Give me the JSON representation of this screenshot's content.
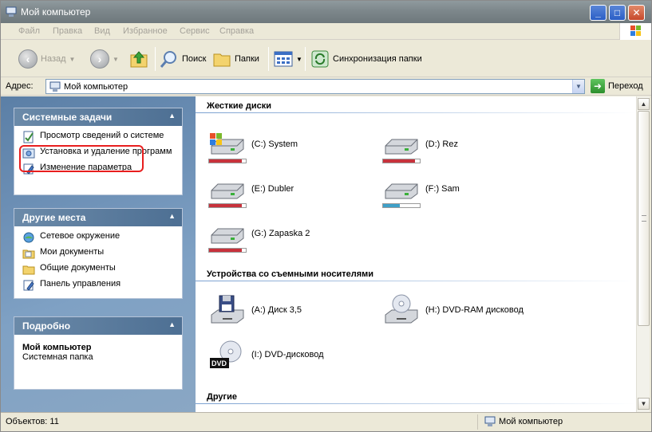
{
  "window": {
    "title": "Мой компьютер",
    "min_glyph": "_",
    "max_glyph": "□",
    "close_glyph": "✕"
  },
  "menu": {
    "items": [
      "Файл",
      "Правка",
      "Вид",
      "Избранное",
      "Сервис",
      "Справка"
    ]
  },
  "toolbar": {
    "back": "Назад",
    "search": "Поиск",
    "folders": "Папки",
    "sync": "Синхронизация папки"
  },
  "address": {
    "label": "Адрес:",
    "value": "Мой компьютер",
    "go": "Переход"
  },
  "left": {
    "system_tasks": {
      "title": "Системные задачи",
      "items": [
        "Просмотр сведений о системе",
        "Установка и удаление программ",
        "Изменение параметра"
      ]
    },
    "other_places": {
      "title": "Другие места",
      "items": [
        "Сетевое окружение",
        "Мои документы",
        "Общие документы",
        "Панель управления"
      ]
    },
    "details": {
      "title": "Подробно",
      "name": "Мой компьютер",
      "sub": "Системная папка"
    }
  },
  "right": {
    "hard_drives_title": "Жесткие диски",
    "hard_drives": [
      {
        "label": "(C:) System",
        "used": 0.9
      },
      {
        "label": "(D:) Rez",
        "used": 0.88
      },
      {
        "label": "(E:) Dubler",
        "used": 0.9
      },
      {
        "label": "(F:) Sam",
        "used": 0.45
      },
      {
        "label": "(G:) Zapaska 2",
        "used": 0.9
      }
    ],
    "removable_title": "Устройства со съемными носителями",
    "removable": [
      {
        "label": "(A:) Диск 3,5"
      },
      {
        "label": "(H:) DVD-RAM дисковод"
      },
      {
        "label": "(I:) DVD-дисковод",
        "badge": "DVD"
      }
    ],
    "other_title": "Другие"
  },
  "status": {
    "objects": "Объектов: 11",
    "location": "Мой компьютер"
  },
  "colors": {
    "bar_red": "#c8323c",
    "bar_blue": "#3fa0c8"
  }
}
